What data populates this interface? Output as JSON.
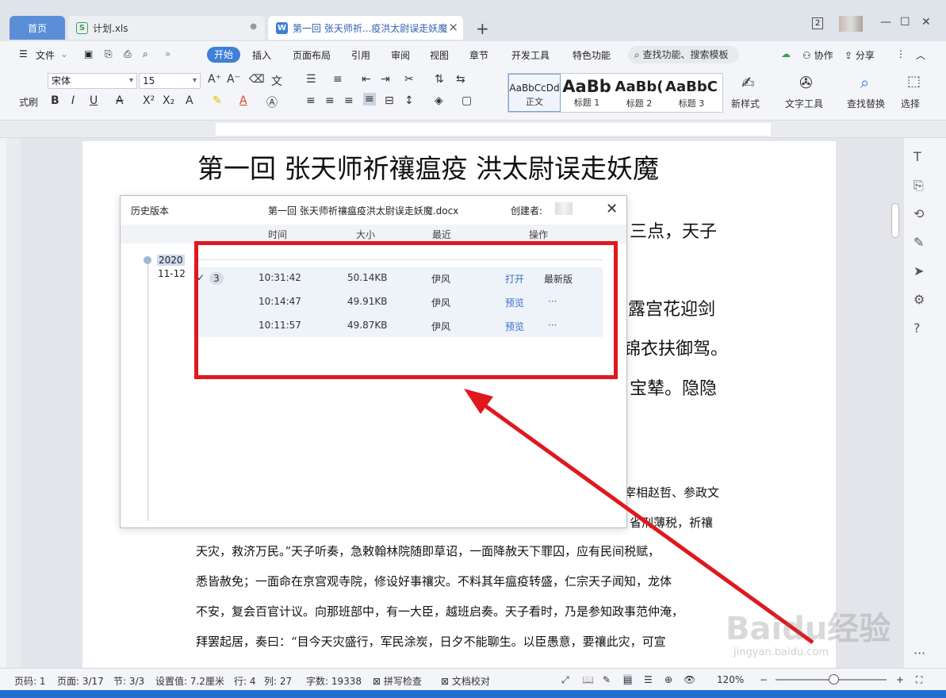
{
  "tabs": {
    "home": "首页",
    "xls": "计划.xls",
    "doc": "第一回 张天师祈...疫洪太尉误走妖魔",
    "xls_icon": "S",
    "doc_icon": "W",
    "add": "+",
    "notif_count": "2"
  },
  "menu": {
    "file": "文件",
    "items": [
      "开始",
      "插入",
      "页面布局",
      "引用",
      "审阅",
      "视图",
      "章节",
      "开发工具",
      "特色功能"
    ],
    "search": "查找功能、搜索模板",
    "collab": "协作",
    "share": "分享"
  },
  "ribbon": {
    "font_name": "宋体",
    "font_size": "15",
    "styles": [
      {
        "preview": "AaBbCcDd",
        "name": "正文"
      },
      {
        "preview": "AaBb",
        "name": "标题 1"
      },
      {
        "preview": "AaBb(",
        "name": "标题 2"
      },
      {
        "preview": "AaBbC",
        "name": "标题 3"
      }
    ],
    "new_style": "新样式",
    "text_tools": "文字工具",
    "find_replace": "查找替换",
    "select": "选择",
    "format_brush": "式刷"
  },
  "document": {
    "title": "第一回  张天师祈禳瘟疫    洪太尉误走妖魔",
    "frag1": "三点，天子",
    "frag2": "露宫花迎剑",
    "frag3": "锦衣扶御驾。",
    "frag4": "宝辇。隐隐",
    "frag5": "宰相赵哲、参政文",
    "frag6": "省刑薄税，祈禳",
    "lines": [
      "天灾，救济万民。”天子听奏，急敕翰林院随即草诏，一面降赦天下罪囚，应有民间税赋，",
      "悉皆赦免；一面命在京宫观寺院，修设好事禳灾。不料其年瘟疫转盛，仁宗天子闻知，龙体",
      "不安，复会百官计议。向那班部中，有一大臣，越班启奏。天子看时，乃是参知政事范仲淹，",
      "拜罢起居，奏曰：“目今天灾盛行，军民涂炭，日夕不能聊生。以臣愚意，要禳此灾，可宣"
    ]
  },
  "history": {
    "title": "历史版本",
    "filename": "第一回 张天师祈禳瘟疫洪太尉误走妖魔.docx",
    "creator_label": "创建者:",
    "close": "✕",
    "col_time": "时间",
    "col_size": "大小",
    "col_recent": "最近",
    "col_action": "操作",
    "year": "2020",
    "date": "11-12",
    "count": "3",
    "rows": [
      {
        "time": "10:31:42",
        "size": "50.14KB",
        "author": "伊风",
        "action": "打开",
        "extra": "最新版"
      },
      {
        "time": "10:14:47",
        "size": "49.91KB",
        "author": "伊风",
        "action": "预览",
        "extra": "···"
      },
      {
        "time": "10:11:57",
        "size": "49.87KB",
        "author": "伊风",
        "action": "预览",
        "extra": "···"
      }
    ]
  },
  "status": {
    "page_no": "页码: 1",
    "pages": "页面: 3/17",
    "section": "节: 3/3",
    "setting": "设置值: 7.2厘米",
    "row": "行: 4",
    "col": "列: 27",
    "words": "字数: 19338",
    "spell": "拼写检查",
    "proof": "文档校对",
    "zoom": "120%"
  },
  "watermark": {
    "brand": "Baidu经验",
    "url": "jingyan.baidu.com"
  },
  "colors": {
    "accent": "#3f7fd8",
    "annotation": "#e0181e",
    "link": "#3a73c9"
  }
}
